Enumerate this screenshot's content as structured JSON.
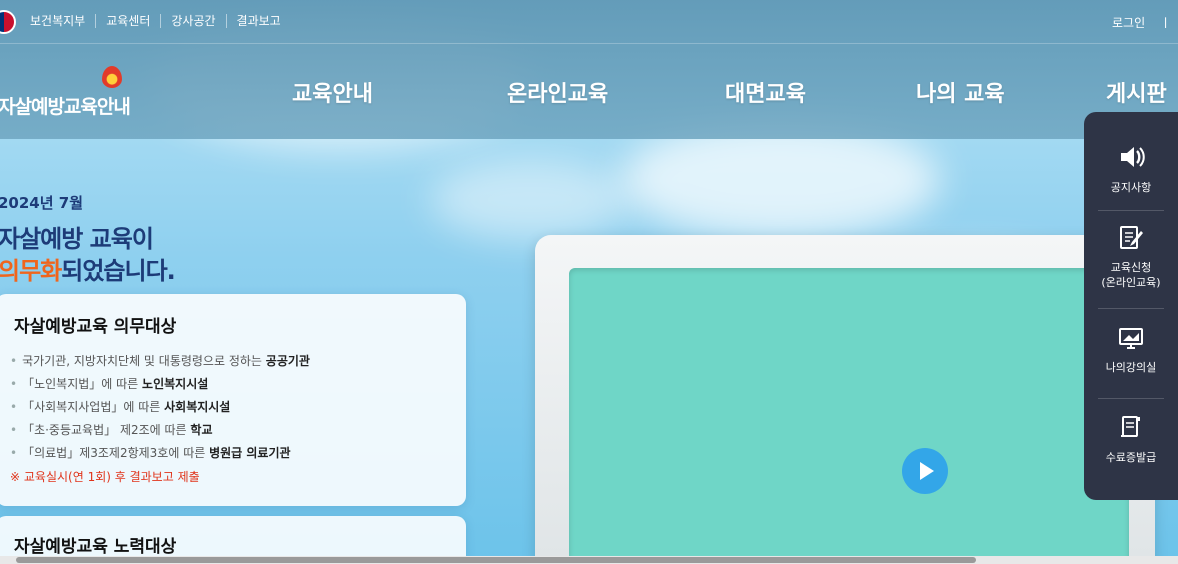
{
  "top_bar": {
    "util_links": [
      "보건복지부",
      "교육센터",
      "강사공간",
      "결과보고"
    ],
    "login": "로그인",
    "sep": "ㅣ"
  },
  "logo": {
    "text": "자살예방교육안내"
  },
  "gnb": {
    "items": [
      "교육안내",
      "온라인교육",
      "대면교육",
      "나의 교육",
      "게시판"
    ]
  },
  "hero": {
    "date": "2024년 7월",
    "line1": "자살예방 교육이",
    "line2_highlight": "의무화",
    "line2_rest": "되었습니다."
  },
  "card_mandatory": {
    "title": "자살예방교육 의무대상",
    "items": [
      {
        "text": "국가기관, 지방자치단체 및 대통령령으로 정하는 ",
        "bold": "공공기관"
      },
      {
        "text": "「노인복지법」에 따른 ",
        "bold": "노인복지시설"
      },
      {
        "text": "「사회복지사업법」에 따른 ",
        "bold": "사회복지시설"
      },
      {
        "text": "「초·중등교육법」 제2조에 따른 ",
        "bold": "학교"
      },
      {
        "text": "「의료법」제3조제2항제3호에 따른 ",
        "bold": "병원급 의료기관"
      }
    ],
    "notice": "※ 교육실시(연 1회) 후 결과보고 제출"
  },
  "card_effort": {
    "title": "자살예방교육 노력대상"
  },
  "quick_menu": {
    "items": [
      {
        "label": "공지사항",
        "icon": "speaker-icon"
      },
      {
        "label": "교육신청\n(온라인교육)",
        "icon": "edit-document-icon"
      },
      {
        "label": "나의강의실",
        "icon": "monitor-icon"
      },
      {
        "label": "수료증발급",
        "icon": "certificate-icon"
      }
    ]
  },
  "video": {
    "play_icon": "play-icon"
  },
  "colors": {
    "accent": "#f0651c",
    "navy": "#1d3b78",
    "quick_bg": "#2e3446",
    "screen": "#6fd6c7",
    "play": "#33a6e8"
  }
}
